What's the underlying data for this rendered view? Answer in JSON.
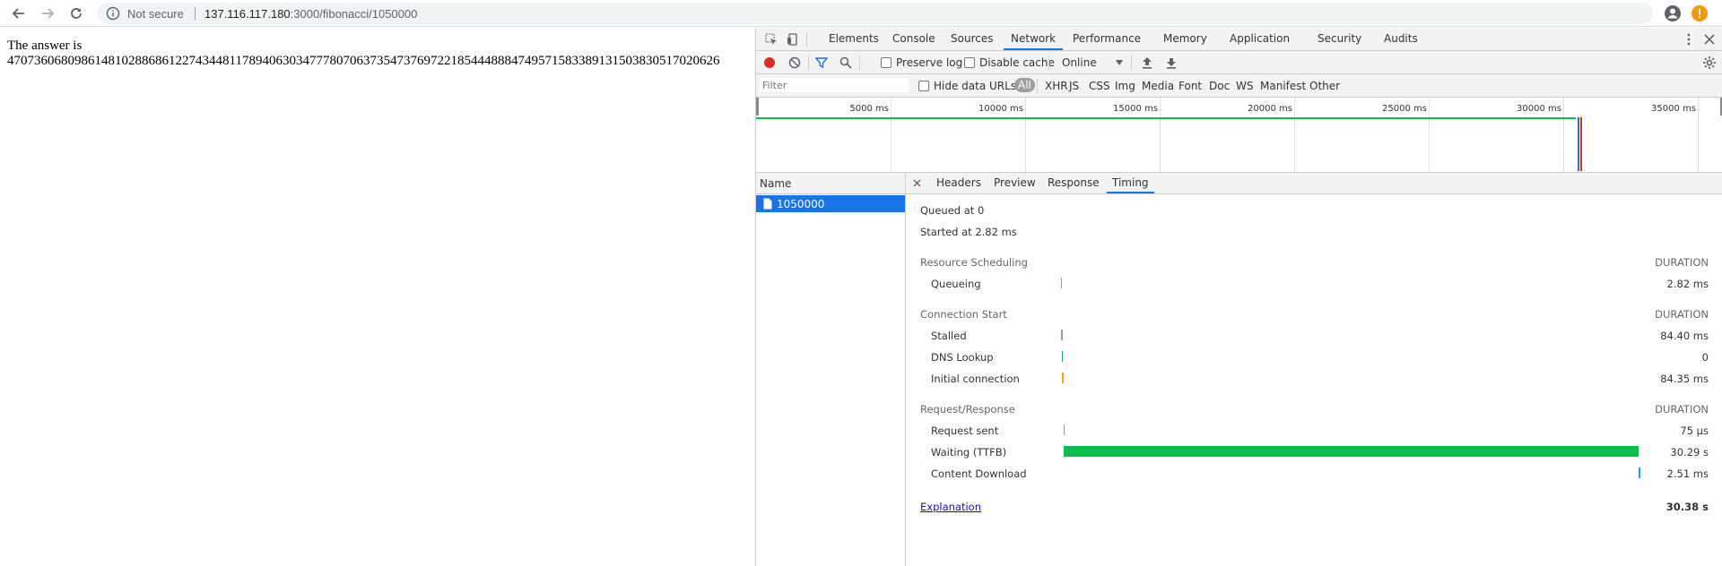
{
  "browser": {
    "security_label": "Not secure",
    "url_host": "137.116.117.180",
    "url_path": ":3000/fibonacci/1050000"
  },
  "page": {
    "line1": "The answer is",
    "line2": "4707360680986148102886861227434481178940630347778070637354737697221854448884749571583389131503830517020626"
  },
  "devtools": {
    "tabs": [
      "Elements",
      "Console",
      "Sources",
      "Network",
      "Performance",
      "Memory",
      "Application",
      "Security",
      "Audits"
    ],
    "active_tab": "Network",
    "toolbar": {
      "preserve_log": "Preserve log",
      "disable_cache": "Disable cache",
      "throttle": "Online"
    },
    "filter": {
      "placeholder": "Filter",
      "hide_data_urls": "Hide data URLs",
      "types": [
        "All",
        "XHR",
        "JS",
        "CSS",
        "Img",
        "Media",
        "Font",
        "Doc",
        "WS",
        "Manifest",
        "Other"
      ]
    },
    "overview_ticks": [
      "5000 ms",
      "10000 ms",
      "15000 ms",
      "20000 ms",
      "25000 ms",
      "30000 ms",
      "35000 ms"
    ],
    "name_header": "Name",
    "request_name": "1050000",
    "detail_tabs": [
      "Headers",
      "Preview",
      "Response",
      "Timing"
    ],
    "active_detail_tab": "Timing",
    "timing": {
      "queued_at": "Queued at 0",
      "started_at": "Started at 2.82 ms",
      "duration_label": "DURATION",
      "sections": [
        {
          "title": "Resource Scheduling",
          "rows": [
            {
              "label": "Queueing",
              "value": "2.82 ms",
              "color": "#9e9e9e"
            }
          ]
        },
        {
          "title": "Connection Start",
          "rows": [
            {
              "label": "Stalled",
              "value": "84.40 ms",
              "color": "#9e9e9e"
            },
            {
              "label": "DNS Lookup",
              "value": "0",
              "color": "#1f9e8f"
            },
            {
              "label": "Initial connection",
              "value": "84.35 ms",
              "color": "#f5a623"
            }
          ]
        },
        {
          "title": "Request/Response",
          "rows": [
            {
              "label": "Request sent",
              "value": "75 µs",
              "color": "#9e9e9e"
            },
            {
              "label": "Waiting (TTFB)",
              "value": "30.29 s",
              "color": "#0cbd4c"
            },
            {
              "label": "Content Download",
              "value": "2.51 ms",
              "color": "#1fa1e0"
            }
          ]
        }
      ],
      "explanation": "Explanation",
      "total": "30.38 s"
    }
  }
}
